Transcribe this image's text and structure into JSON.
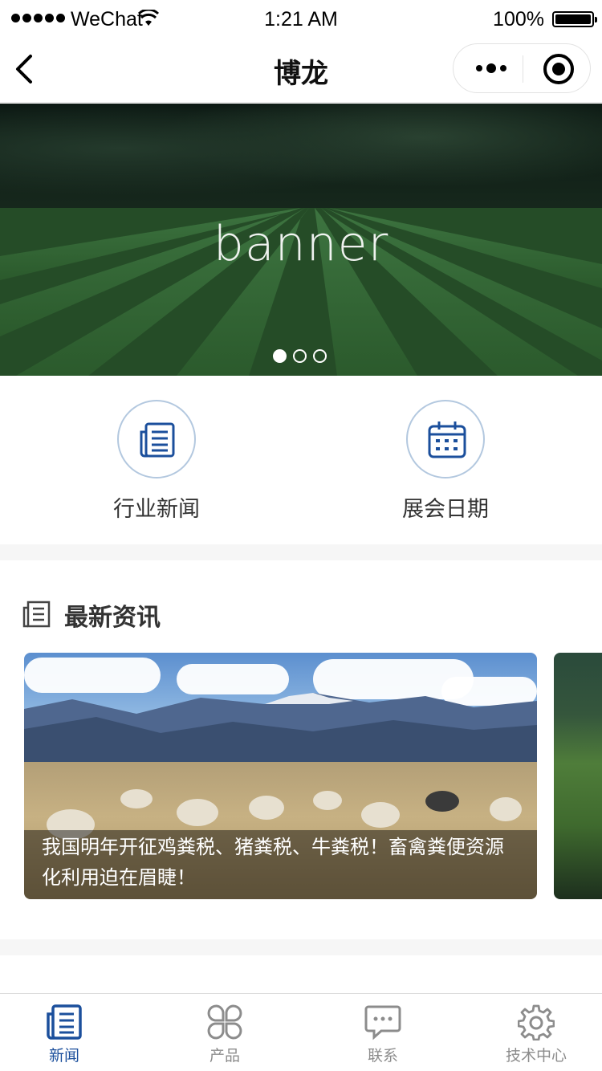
{
  "status_bar": {
    "carrier": "WeChat",
    "time": "1:21 AM",
    "battery": "100%"
  },
  "nav": {
    "title": "博龙"
  },
  "banner": {
    "text": "banner",
    "slide_count": 3,
    "active_slide": 1
  },
  "quick_entries": [
    {
      "label": "行业新闻",
      "icon": "newspaper-icon"
    },
    {
      "label": "展会日期",
      "icon": "calendar-icon"
    }
  ],
  "news_section": {
    "title": "最新资讯",
    "icon": "news-list-icon",
    "articles": [
      {
        "caption": "我国明年开征鸡粪税、猪粪税、牛粪税！畜禽粪便资源化利用迫在眉睫！"
      }
    ]
  },
  "tab_bar": {
    "items": [
      {
        "label": "新闻",
        "icon": "newspaper-icon",
        "active": true
      },
      {
        "label": "产品",
        "icon": "grid-flower-icon",
        "active": false
      },
      {
        "label": "联系",
        "icon": "chat-bubble-icon",
        "active": false
      },
      {
        "label": "技术中心",
        "icon": "gear-icon",
        "active": false
      }
    ]
  },
  "colors": {
    "accent": "#1b4f9c",
    "inactive": "#8c8c8c",
    "divider": "#f6f6f6"
  }
}
